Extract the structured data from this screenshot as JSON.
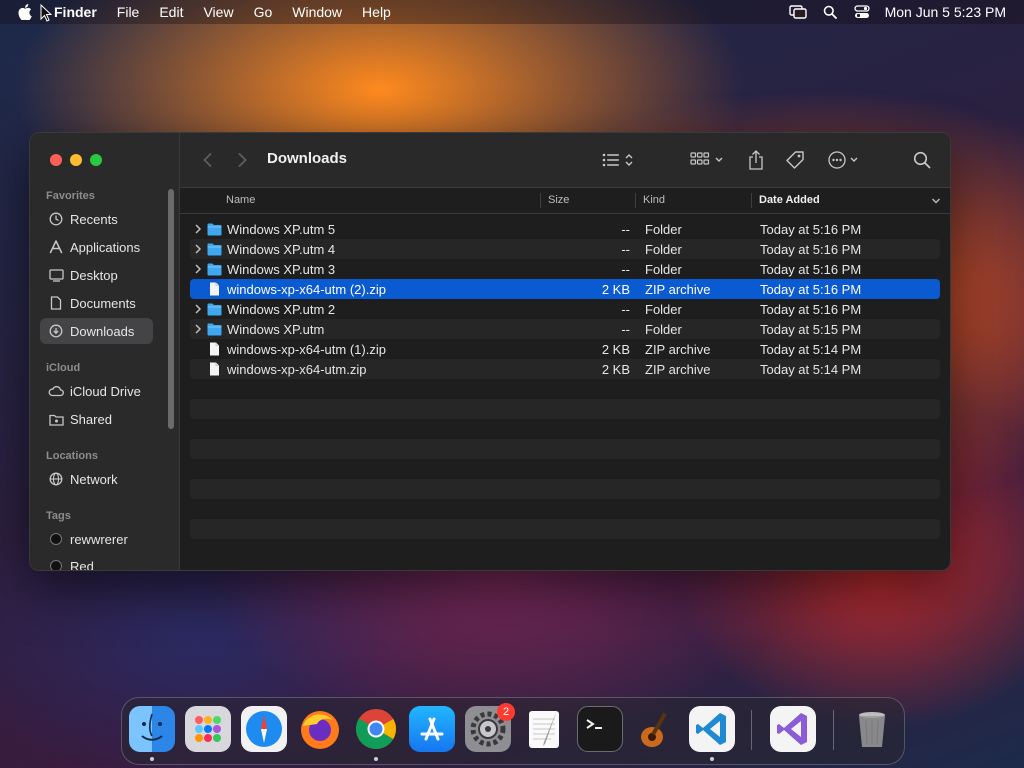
{
  "menubar": {
    "app": "Finder",
    "items": [
      "File",
      "Edit",
      "View",
      "Go",
      "Window",
      "Help"
    ],
    "clock": "Mon Jun 5  5:23 PM",
    "icons": [
      "screen-mirroring-icon",
      "search-icon",
      "control-center-icon"
    ]
  },
  "window": {
    "title": "Downloads",
    "traffic_colors": {
      "close": "#fe5f57",
      "minimize": "#febc2e",
      "zoom": "#28c840"
    }
  },
  "sidebar": {
    "favorites_label": "Favorites",
    "favorites": [
      {
        "label": "Recents",
        "icon": "clock-icon"
      },
      {
        "label": "Applications",
        "icon": "applications-icon"
      },
      {
        "label": "Desktop",
        "icon": "desktop-icon"
      },
      {
        "label": "Documents",
        "icon": "document-icon"
      },
      {
        "label": "Downloads",
        "icon": "download-icon",
        "active": true
      }
    ],
    "icloud_label": "iCloud",
    "icloud": [
      {
        "label": "iCloud Drive",
        "icon": "cloud-icon"
      },
      {
        "label": "Shared",
        "icon": "shared-folder-icon"
      }
    ],
    "locations_label": "Locations",
    "locations": [
      {
        "label": "Network",
        "icon": "globe-icon"
      }
    ],
    "tags_label": "Tags",
    "tags": [
      {
        "label": "rewwrerer"
      },
      {
        "label": "Red"
      }
    ]
  },
  "columns": {
    "name": "Name",
    "size": "Size",
    "kind": "Kind",
    "date": "Date Added"
  },
  "files": [
    {
      "name": "Windows XP.utm 5",
      "size": "--",
      "kind": "Folder",
      "date": "Today at 5:16 PM",
      "type": "folder"
    },
    {
      "name": "Windows XP.utm 4",
      "size": "--",
      "kind": "Folder",
      "date": "Today at 5:16 PM",
      "type": "folder"
    },
    {
      "name": "Windows XP.utm 3",
      "size": "--",
      "kind": "Folder",
      "date": "Today at 5:16 PM",
      "type": "folder"
    },
    {
      "name": "windows-xp-x64-utm (2).zip",
      "size": "2 KB",
      "kind": "ZIP archive",
      "date": "Today at 5:16 PM",
      "type": "zip",
      "selected": true
    },
    {
      "name": "Windows XP.utm 2",
      "size": "--",
      "kind": "Folder",
      "date": "Today at 5:16 PM",
      "type": "folder"
    },
    {
      "name": "Windows XP.utm",
      "size": "--",
      "kind": "Folder",
      "date": "Today at 5:15 PM",
      "type": "folder"
    },
    {
      "name": "windows-xp-x64-utm (1).zip",
      "size": "2 KB",
      "kind": "ZIP archive",
      "date": "Today at 5:14 PM",
      "type": "zip"
    },
    {
      "name": "windows-xp-x64-utm.zip",
      "size": "2 KB",
      "kind": "ZIP archive",
      "date": "Today at 5:14 PM",
      "type": "zip"
    }
  ],
  "dock": {
    "apps": [
      "finder-icon",
      "launchpad-icon",
      "safari-icon",
      "firefox-icon",
      "chrome-icon",
      "app-store-icon",
      "system-settings-icon",
      "textedit-icon",
      "terminal-icon",
      "garageband-icon",
      "vscode-icon",
      "visual-studio-icon",
      "trash-icon"
    ],
    "settings_badge": "2"
  },
  "colors": {
    "selection": "#0a5bd1",
    "folder": "#3fa6f0"
  }
}
